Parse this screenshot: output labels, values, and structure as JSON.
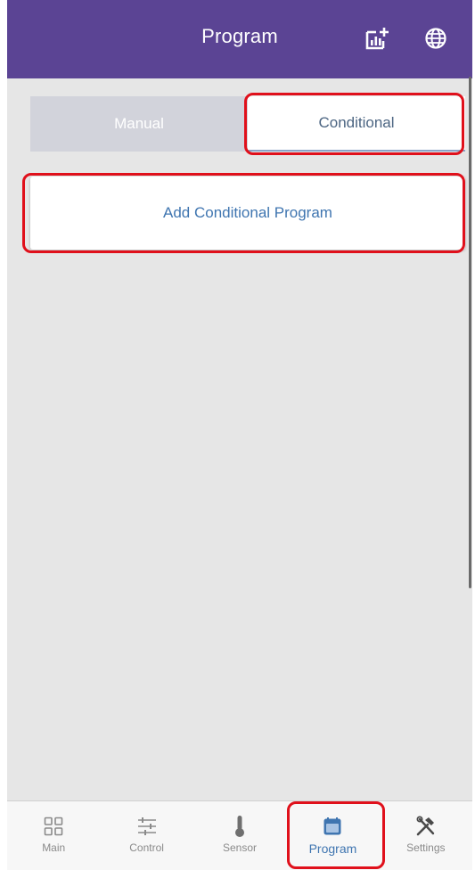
{
  "header": {
    "title": "Program",
    "chart_icon": "chart-add-icon",
    "globe_icon": "globe-icon",
    "background_color": "#5b4494"
  },
  "tabs": [
    {
      "label": "Manual",
      "selected": false
    },
    {
      "label": "Conditional",
      "selected": true
    }
  ],
  "main": {
    "add_button_label": "Add Conditional Program"
  },
  "bottom_nav": {
    "items": [
      {
        "label": "Main",
        "icon": "grid-icon",
        "active": false
      },
      {
        "label": "Control",
        "icon": "sliders-icon",
        "active": false
      },
      {
        "label": "Sensor",
        "icon": "thermometer-icon",
        "active": false
      },
      {
        "label": "Program",
        "icon": "calendar-icon",
        "active": true
      },
      {
        "label": "Settings",
        "icon": "tools-icon",
        "active": false
      }
    ]
  },
  "colors": {
    "accent": "#3f75b0",
    "highlight": "#e0101b"
  }
}
